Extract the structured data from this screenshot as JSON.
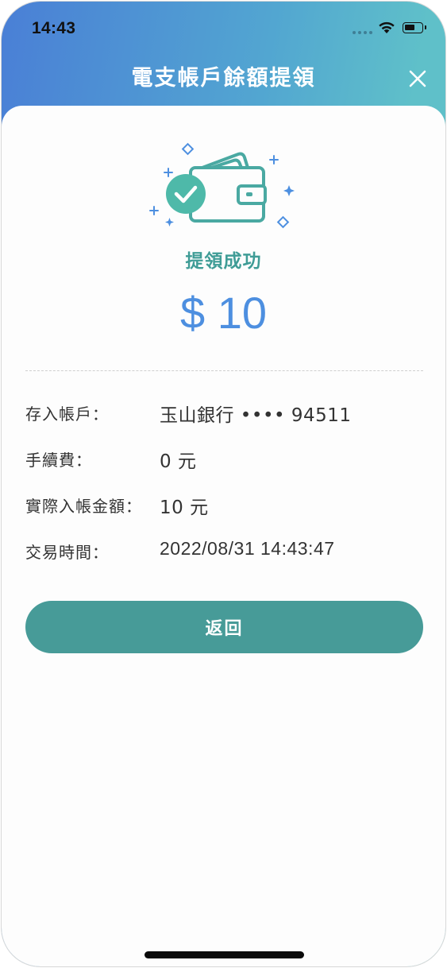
{
  "status_bar": {
    "time": "14:43"
  },
  "header": {
    "title": "電支帳戶餘額提領",
    "close_icon": "close-icon"
  },
  "result": {
    "title": "提領成功",
    "amount": "$ 10"
  },
  "details": [
    {
      "label": "存入帳戶：",
      "value": "玉山銀行 •••• 94511"
    },
    {
      "label": "手續費：",
      "value": "0 元"
    },
    {
      "label": "實際入帳金額：",
      "value": "10 元"
    },
    {
      "label": "交易時間：",
      "value": "2022/08/31 14:43:47"
    }
  ],
  "actions": {
    "return_label": "返回"
  },
  "colors": {
    "gradient_start": "#4a7fd6",
    "gradient_end": "#5fc0c9",
    "success_teal": "#3f9c96",
    "amount_blue": "#4d8fe0",
    "button_teal": "#479b98"
  }
}
